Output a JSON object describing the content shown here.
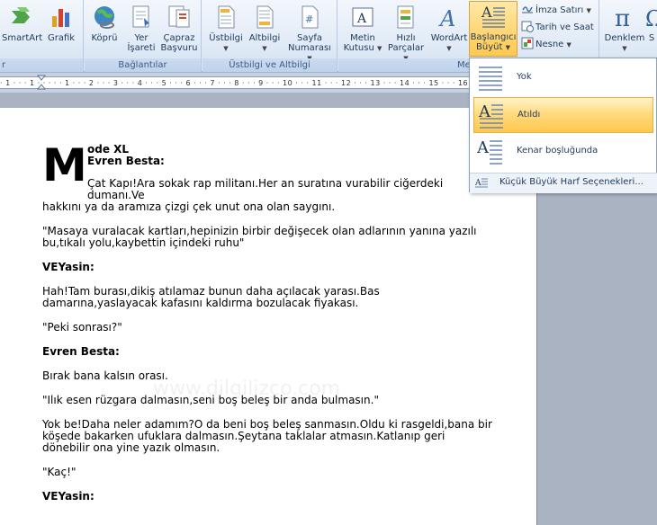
{
  "ribbon": {
    "groups": {
      "illustrations_label": "r",
      "links_label": "Bağlantılar",
      "header_footer_label": "Üstbilgi ve Altbilgi",
      "text_label": "Me"
    },
    "buttons": {
      "smartart": "SmartArt",
      "grafik": "Grafik",
      "kopru": "Köprü",
      "yer_isareti_1": "Yer",
      "yer_isareti_2": "İşareti",
      "capraz_1": "Çapraz",
      "capraz_2": "Başvuru",
      "ustbilgi": "Üstbilgi",
      "altbilgi": "Altbilgi",
      "sayfa_1": "Sayfa",
      "sayfa_2": "Numarası",
      "metin_1": "Metin",
      "metin_2": "Kutusu",
      "hizli_1": "Hızlı",
      "hizli_2": "Parçalar",
      "wordart": "WordArt",
      "baslangic_1": "Başlangıcı",
      "baslangic_2": "Büyüt",
      "imza": "İmza Satırı",
      "tarih": "Tarih ve Saat",
      "nesne": "Nesne",
      "denklem": "Denklem",
      "simge_partial": "S"
    }
  },
  "ruler": {
    "text": "· 1 · · · 1 · · · · · 1 · · · 2 · · · 3 · · · 4 · · · 5 · · · 6 · · · 7 · · · 8 · · · 9 · · · 10 · · · 11 · · · 12 · · · 13 · · · 14 · · · 15 · · · 16 ·"
  },
  "gallery": {
    "options": [
      {
        "label": "Yok"
      },
      {
        "label": "Atıldı"
      },
      {
        "label": "Kenar boşluğunda"
      }
    ],
    "footer": "Küçük Büyük Harf Seçenekleri..."
  },
  "document": {
    "dropcap": "M",
    "line1": "ode XL",
    "line2": "Evren Besta:",
    "para1_first": "Çat Kapı!Ara sokak rap militanı.Her an suratına vurabilir ciğerdeki dumanı.Ve",
    "para1_rest": "hakkını ya da aramıza çizgi çek unut ona olan saygını.",
    "para2": "\"Masaya vuralacak kartları,hepinizin birbir değişecek olan adlarının yanına yazılı bu,tıkalı yolu,kaybettin içindeki ruhu\"",
    "h2": "VEYasin:",
    "para3": "Hah!Tam burası,dikiş atılamaz bunun daha açılacak yarası.Bas damarına,yaslayacak kafasını kaldırma bozulacak fiyakası.",
    "para4": "\"Peki sonrası?\"",
    "h3": "Evren Besta:",
    "para5": "Bırak bana kalsın orası.",
    "para6": "\"Ilık esen rüzgara dalmasın,seni boş beleş bir anda bulmasın.\"",
    "para7": "Yok be!Daha neler adamım?O da beni boş beleş sanmasın.Oldu ki rasgeldi,bana bir köşede bakarken ufuklara dalmasın.Şeytana taklalar atmasın.Katlanıp geri dönebilir ona yine yazık olmasın.",
    "para8": "\"Kaç!\"",
    "h4": "VEYasin:",
    "watermark": "www.dilgilizco.com"
  }
}
